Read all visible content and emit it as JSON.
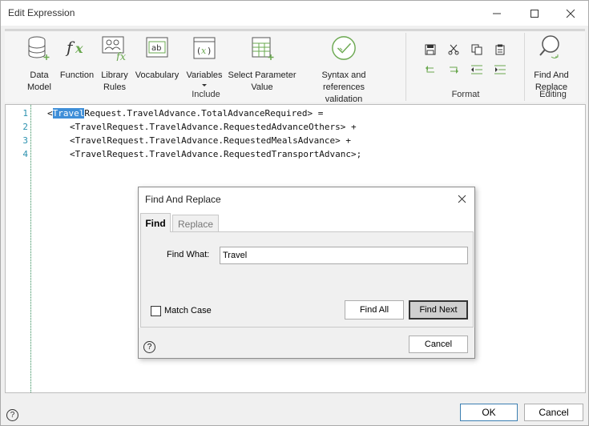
{
  "window": {
    "title": "Edit Expression"
  },
  "ribbon": {
    "buttons": {
      "data_model": "Data\nModel",
      "function": "Function",
      "library_rules": "Library\nRules",
      "vocabulary": "Vocabulary",
      "variables": "Variables",
      "select_parameter_value": "Select Parameter\nValue",
      "syntax_validation": "Syntax and references\nvalidation",
      "find_and_replace": "Find And\nReplace"
    },
    "groups": {
      "include": "Include",
      "format": "Format",
      "editing": "Editing"
    }
  },
  "editor": {
    "lines": [
      {
        "num": "1",
        "before": "<",
        "highlight": "Travel",
        "after": "Request.TravelAdvance.TotalAdvanceRequired> ="
      },
      {
        "num": "2",
        "text": "<TravelRequest.TravelAdvance.RequestedAdvanceOthers> +"
      },
      {
        "num": "3",
        "text": "<TravelRequest.TravelAdvance.RequestedMealsAdvance> +"
      },
      {
        "num": "4",
        "text": "<TravelRequest.TravelAdvance.RequestedTransportAdvanc>;"
      }
    ]
  },
  "dialog": {
    "title": "Find And Replace",
    "tabs": {
      "find": "Find",
      "replace": "Replace"
    },
    "find_what_label": "Find What:",
    "find_what_value": "Travel",
    "match_case_label": "Match Case",
    "find_all": "Find All",
    "find_next": "Find Next",
    "cancel": "Cancel",
    "help_glyph": "?"
  },
  "footer": {
    "ok": "OK",
    "cancel": "Cancel",
    "help_glyph": "?"
  },
  "colors": {
    "selection": "#3e8ed8",
    "line_numbers": "#2b91af",
    "accent_green": "#6aa84f"
  }
}
